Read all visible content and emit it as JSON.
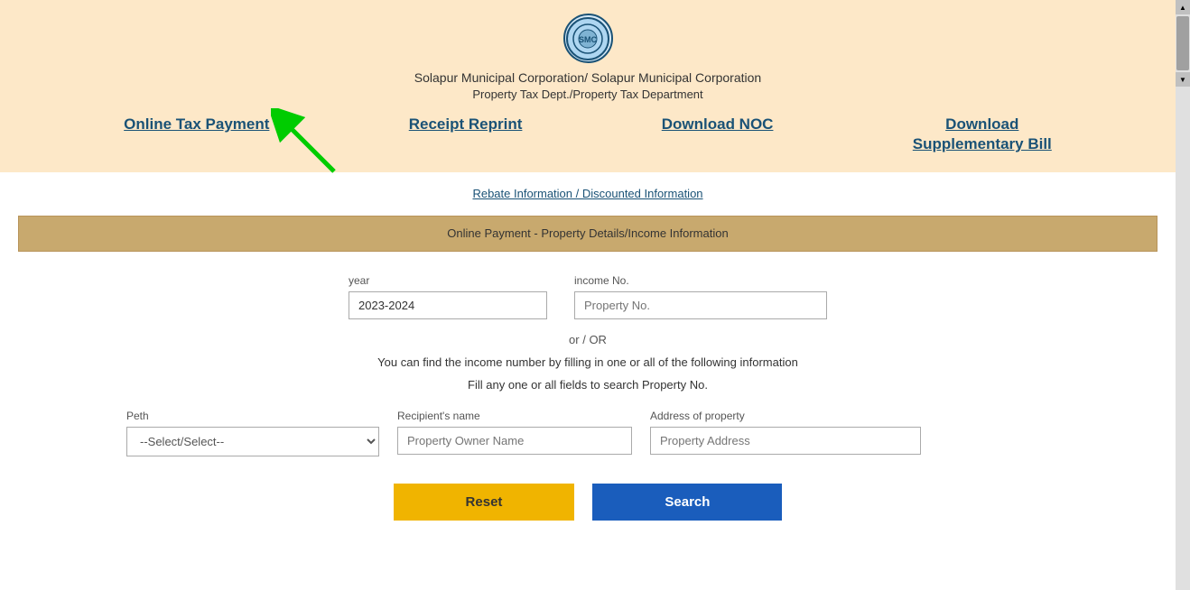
{
  "header": {
    "org_name": "Solapur Municipal Corporation/ Solapur Municipal Corporation",
    "dept_name": "Property Tax Dept./Property Tax Department"
  },
  "nav": {
    "link1": "Online Tax Payment",
    "link2": "Receipt Reprint",
    "link3": "Download NOC",
    "link4_line1": "Download",
    "link4_line2": "Supplementary Bill"
  },
  "rebate": {
    "link_text": "Rebate Information / Discounted Information"
  },
  "form_header": {
    "title": "Online Payment - Property Details/Income Information"
  },
  "year_field": {
    "label": "year",
    "value": "2023-2024"
  },
  "income_field": {
    "label": "income No.",
    "placeholder": "Property No."
  },
  "or_text": "or / OR",
  "info_text": "You can find the income number by filling in one or all of the following information",
  "fill_text": "Fill any one or all fields to search Property No.",
  "peth": {
    "label": "Peth",
    "placeholder": "--Select/Select--"
  },
  "recipient": {
    "label": "Recipient's name",
    "placeholder": "Property Owner Name"
  },
  "address": {
    "label": "Address of property",
    "placeholder": "Property Address"
  },
  "buttons": {
    "reset": "Reset",
    "search": "Search"
  }
}
